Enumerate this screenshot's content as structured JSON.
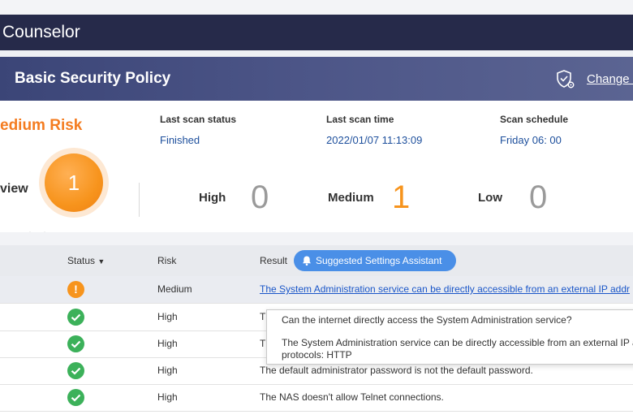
{
  "app": {
    "title": "Counselor"
  },
  "policy": {
    "title": "Basic Security Policy",
    "change_link": "Change S",
    "change_icon": "shield-gear-icon"
  },
  "summary": {
    "risk_title": "edium Risk",
    "overview_label": "view",
    "badge_count": "1",
    "last_scan_status": {
      "label": "Last scan status",
      "value": "Finished"
    },
    "last_scan_time": {
      "label": "Last scan time",
      "value": "2022/01/07 11:13:09"
    },
    "scan_schedule": {
      "label": "Scan schedule",
      "value": "Friday 06: 00"
    },
    "counts": {
      "high": {
        "label": "High",
        "value": "0"
      },
      "medium": {
        "label": "Medium",
        "value": "1"
      },
      "low": {
        "label": "Low",
        "value": "0"
      }
    }
  },
  "table": {
    "headers": {
      "status": "Status",
      "risk": "Risk",
      "result": "Result"
    },
    "assist_button": "Suggested Settings Assistant",
    "rows": [
      {
        "status": "warning",
        "risk": "Medium",
        "result": "The System Administration service can be directly accessible from an external IP addr"
      },
      {
        "status": "ok",
        "risk": "High",
        "result": "Th"
      },
      {
        "status": "ok",
        "risk": "High",
        "result": "Th"
      },
      {
        "status": "ok",
        "risk": "High",
        "result": "The default administrator password is not the default password."
      },
      {
        "status": "ok",
        "risk": "High",
        "result": "The NAS doesn't allow Telnet connections."
      }
    ]
  },
  "tooltip": {
    "question": "Can the internet directly access the System Administration service?",
    "line1": "The System Administration service can be directly accessible from an external IP addre",
    "line2": "protocols: HTTP"
  },
  "colors": {
    "accent_orange": "#f7941d",
    "ok_green": "#3cb15a",
    "link_blue": "#1a56c8",
    "header_navy": "#262a4a"
  }
}
